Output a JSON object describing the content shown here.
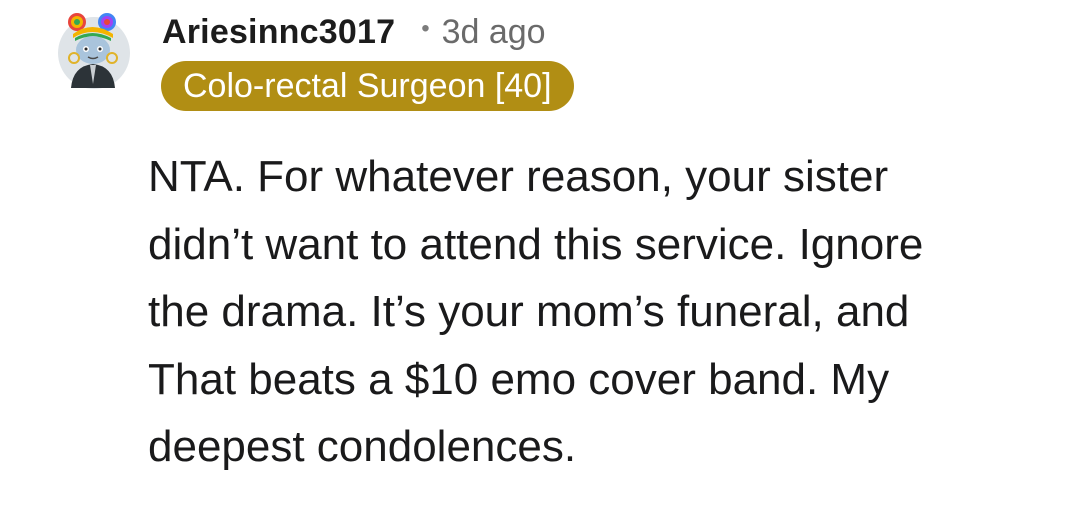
{
  "comment": {
    "username": "Ariesinnc3017",
    "separator": "•",
    "timestamp": "3d ago",
    "flair": "Colo-rectal Surgeon [40]",
    "body_lines": [
      "NTA. For whatever reason, your sister",
      "didn’t want to attend this service. Ignore",
      "the drama. It’s your mom’s funeral, and",
      "That beats a $10 emo cover band. My",
      "deepest condolences."
    ]
  },
  "colors": {
    "flair_background": "#b18e14",
    "flair_text": "#ffffff",
    "username": "#1c1c1c",
    "timestamp": "#6a6a6a"
  },
  "icons": {
    "avatar": "user-avatar-icon"
  }
}
